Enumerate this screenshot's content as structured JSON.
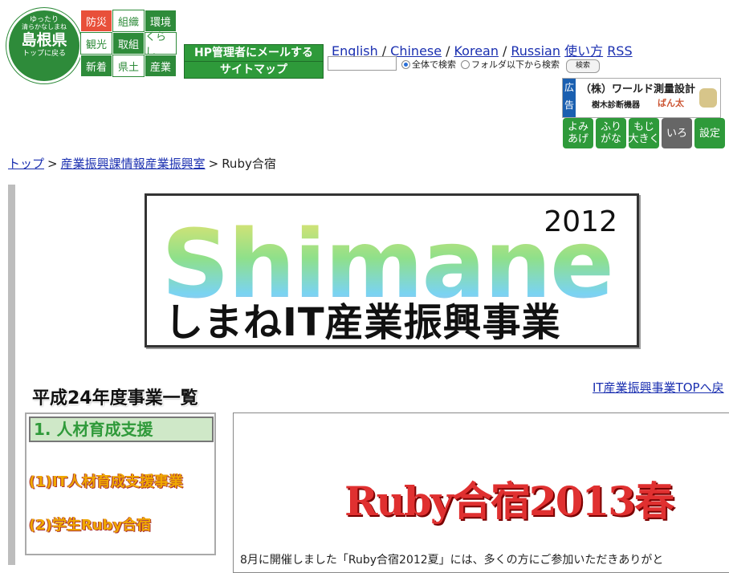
{
  "logo": {
    "line1": "ゆったり",
    "line2": "清らかなしまね",
    "line3": "島根県",
    "line4": "トップに戻る"
  },
  "categories": [
    {
      "label": "防災",
      "style": "red"
    },
    {
      "label": "組織",
      "style": "white"
    },
    {
      "label": "環境",
      "style": "green"
    },
    {
      "label": "観光",
      "style": "white"
    },
    {
      "label": "取組",
      "style": "green"
    },
    {
      "label": "くらし",
      "style": "white"
    },
    {
      "label": "新着",
      "style": "green"
    },
    {
      "label": "県土",
      "style": "white"
    },
    {
      "label": "産業",
      "style": "green"
    }
  ],
  "header": {
    "mail_label": "HP管理者にメールする",
    "sitemap_label": "サイトマップ"
  },
  "languages": [
    {
      "label": "English"
    },
    {
      "label": "Chinese"
    },
    {
      "label": "Korean"
    },
    {
      "label": "Russian"
    }
  ],
  "help_label": "使い方",
  "rss_label": "RSS",
  "search": {
    "value": "",
    "radio_all": "全体で検索",
    "radio_folder": "フォルダ以下から検索",
    "button": "検索"
  },
  "ad": {
    "tag": "広告",
    "company": "（株）ワールド測量設計",
    "sub": "樹木診断機器",
    "product": "ばん太"
  },
  "accessibility": [
    {
      "label": "よみ\nあげ",
      "style": "green"
    },
    {
      "label": "ふり\nがな",
      "style": "green"
    },
    {
      "label": "もじ\n大きく",
      "style": "green"
    },
    {
      "label": "いろ",
      "style": "gray"
    },
    {
      "label": "設定",
      "style": "green"
    }
  ],
  "breadcrumb": {
    "top": "トップ",
    "section": "産業振興課情報産業振興室",
    "current": "Ruby合宿"
  },
  "banner": {
    "word": "Shimane",
    "year": "2012",
    "subtitle": "しまねIT産業振興事業"
  },
  "section_title": "平成24年度事業一覧",
  "top_link": "IT産業振興事業TOPへ戻",
  "menu": {
    "heading": "1. 人材育成支援",
    "items": [
      {
        "label": "(1)IT人材育成支援事業"
      },
      {
        "label": "(2)学生Ruby合宿"
      }
    ]
  },
  "content": {
    "title": "Ruby合宿2013春",
    "paragraph": "8月に開催しました「Ruby合宿2012夏」には、多くの方にご参加いただきありがと"
  },
  "colors": {
    "green": "#2e9a3a",
    "red": "#e8503a",
    "link": "#1a2fb0"
  }
}
